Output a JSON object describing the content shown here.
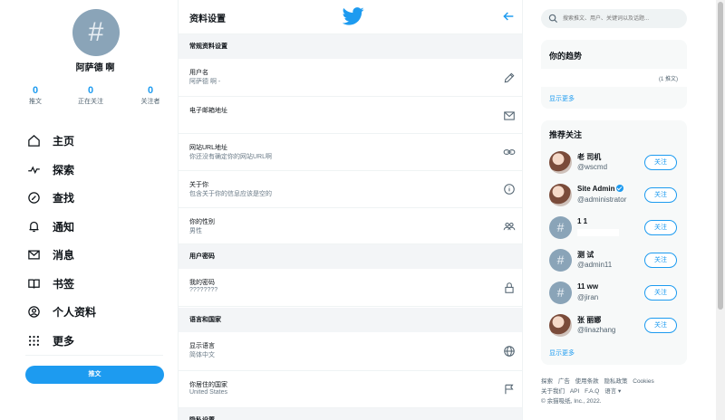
{
  "profile": {
    "avatar_glyph": "#",
    "name": "阿萨德 啊",
    "stats": [
      {
        "value": "0",
        "label": "推文"
      },
      {
        "value": "0",
        "label": "正在关注"
      },
      {
        "value": "0",
        "label": "关注者"
      }
    ]
  },
  "nav": {
    "items": [
      {
        "label": "主页",
        "icon": "home-icon"
      },
      {
        "label": "探索",
        "icon": "trend-icon"
      },
      {
        "label": "查找",
        "icon": "compass-icon"
      },
      {
        "label": "通知",
        "icon": "bell-icon"
      },
      {
        "label": "消息",
        "icon": "mail-icon"
      },
      {
        "label": "书签",
        "icon": "book-icon"
      },
      {
        "label": "个人资料",
        "icon": "profile-icon"
      },
      {
        "label": "更多",
        "icon": "more-icon"
      }
    ],
    "tweet_button": "推文"
  },
  "settings": {
    "title": "资料设置",
    "sections": {
      "general": "常规资料设置",
      "password": "用户密码",
      "language": "语言和国家",
      "privacy": "隐私设置"
    },
    "rows": {
      "username": {
        "label": "用户名",
        "value": "阿萨德 啊 -"
      },
      "email": {
        "label": "电子邮箱地址",
        "value": ""
      },
      "url": {
        "label": "网站URL地址",
        "value": "你还没有确定你的网站URL啊"
      },
      "about": {
        "label": "关于你",
        "value": "包含关于你的信息应该是空的"
      },
      "gender": {
        "label": "你的性别",
        "value": "男性"
      },
      "my_password": {
        "label": "我的密码",
        "value": "????????"
      },
      "display_language": {
        "label": "显示语言",
        "value": "简体中文"
      },
      "country": {
        "label": "你居住的国家",
        "value": "United States"
      }
    }
  },
  "search": {
    "placeholder": "搜索推文、用户、关键词以及话题..."
  },
  "trends": {
    "title": "你的趋势",
    "count": "(1 推文)",
    "show_more": "显示更多"
  },
  "follow": {
    "title": "推荐关注",
    "button_label": "关注",
    "show_more": "显示更多",
    "users": [
      {
        "name": "老 司机",
        "handle": "@wscmd",
        "photo": true,
        "verified": false
      },
      {
        "name": "Site Admin",
        "handle": "@administrator",
        "photo": true,
        "verified": true
      },
      {
        "name": "1 1",
        "handle": "",
        "photo": false,
        "verified": false
      },
      {
        "name": "测 试",
        "handle": "@admin11",
        "photo": false,
        "verified": false
      },
      {
        "name": "11 ww",
        "handle": "@jiran",
        "photo": false,
        "verified": false
      },
      {
        "name": "张 丽娜",
        "handle": "@linazhang",
        "photo": true,
        "verified": false
      }
    ]
  },
  "footer": {
    "links_line1": [
      "探索",
      "广告",
      "使用条款",
      "隐私政策",
      "Cookies"
    ],
    "links_line2": [
      "关于我们",
      "API",
      "F.A.Q",
      "语言 ▾"
    ],
    "copyright": "© 余猫吸纸, Inc., 2022."
  },
  "colors": {
    "accent": "#1d9bf0",
    "section_bg": "#f3f5f7",
    "card_bg": "#f7f9f9"
  }
}
